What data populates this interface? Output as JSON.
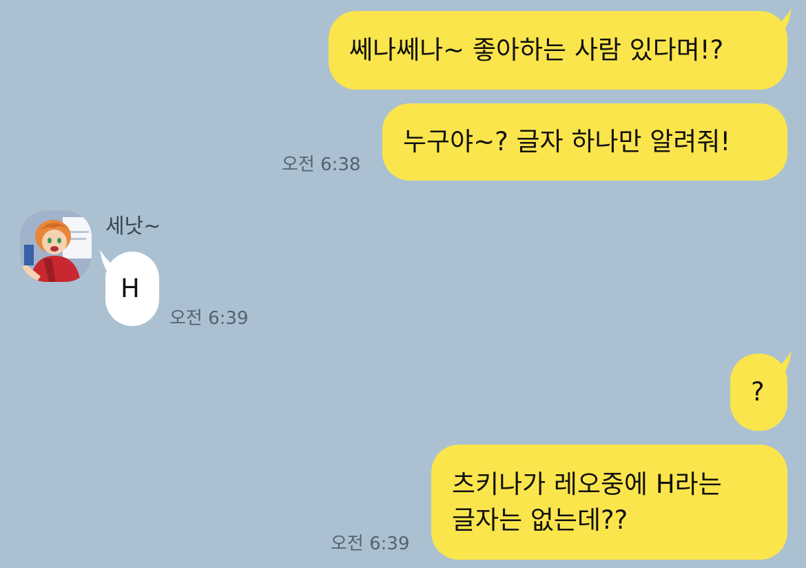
{
  "colors": {
    "background": "#abc1d1",
    "my_bubble": "#fbe54c",
    "their_bubble": "#ffffff",
    "timestamp": "#556170"
  },
  "messages": {
    "m1": {
      "text": "쎄나쎄나~ 좋아하는 사람 있다며!?"
    },
    "m2": {
      "text": "누구야~? 글자 하나만 알려줘!",
      "time": "오전 6:38"
    },
    "reply": {
      "sender": "세낫~",
      "text": "H",
      "time": "오전 6:39",
      "avatar_icon": "profile-avatar"
    },
    "m3": {
      "text": "?"
    },
    "m4": {
      "line1": "츠키나가 레오중에 H라는",
      "line2": "글자는 없는데??",
      "time": "오전 6:39"
    }
  }
}
